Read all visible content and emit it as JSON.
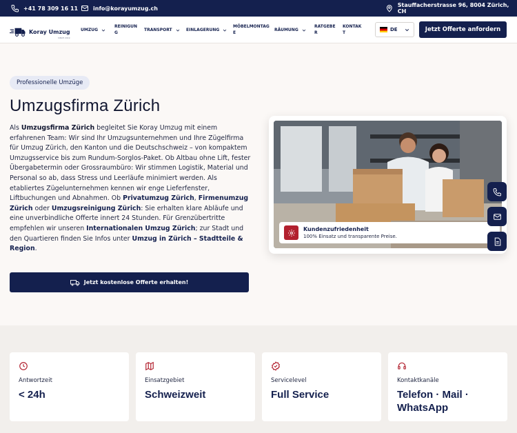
{
  "topbar": {
    "phone": "+41 78 309 16 11",
    "email": "info@korayumzug.ch",
    "address": "Stauffacherstrasse 96, 8004 Zürich, CH"
  },
  "nav": {
    "logo_text": "Koray Umzug",
    "logo_sub": "SINCE 2019",
    "items": [
      {
        "label": "UMZUG"
      },
      {
        "label": "REINIGUN G"
      },
      {
        "label": "TRANSPORT"
      },
      {
        "label": "EINLAGERUNG"
      },
      {
        "label": "MÖBELMONTAG E"
      },
      {
        "label": "RÄUMUNG"
      },
      {
        "label": "RATGEBE R"
      },
      {
        "label": "KONTAK T"
      }
    ],
    "language": "DE",
    "cta": "Jetzt Offerte anfordern"
  },
  "hero": {
    "badge": "Professionelle Umzüge",
    "title": "Umzugsfirma Zürich",
    "p": [
      "Als ",
      "Umzugsfirma Zürich",
      " begleitet Sie Koray Umzug mit einem erfahrenen Team: Wir sind Ihr Umzugsunternehmen und Ihre Zügelfirma für Umzug Zürich, den Kanton und die Deutschschweiz – von kompaktem Umzugsservice bis zum Rundum-Sorglos-Paket. Ob Altbau ohne Lift, fester Übergabetermin oder Grossraumbüro: Wir stimmen Logistik, Material und Personal so ab, dass Stress und Leerläufe minimiert werden. Als etabliertes Zügelunternehmen kennen wir enge Lieferfenster, Liftbuchungen und Abnahmen. Ob ",
      "Privatumzug Zürich",
      ", ",
      "Firmenumzug Zürich",
      " oder ",
      "Umzugsreinigung Zürich",
      ": Sie erhalten klare Abläufe und eine unverbindliche Offerte innert 24 Stunden. Für Grenzübertritte empfehlen wir unseren ",
      "Internationalen Umzug Zürich",
      "; zur Stadt und den Quartieren finden Sie Infos unter ",
      "Umzug in Zürich – Stadtteile & Region",
      "."
    ],
    "cta": "Jetzt kostenlose Offerte erhalten!"
  },
  "overlay": {
    "title": "Kundenzufriedenheit",
    "subtitle": "100% Einsatz und transparente Preise."
  },
  "stats": [
    {
      "icon": "clock-icon",
      "label": "Antwortzeit",
      "value": "< 24h"
    },
    {
      "icon": "map-icon",
      "label": "Einsatzgebiet",
      "value": "Schweizweit"
    },
    {
      "icon": "badge-check-icon",
      "label": "Servicelevel",
      "value": "Full Service"
    },
    {
      "icon": "headset-icon",
      "label": "Kontaktkanäle",
      "value": "Telefon · Mail · WhatsApp"
    }
  ],
  "colors": {
    "navy": "#14204e",
    "accent_red": "#b2202e",
    "background": "#fbf8f6",
    "band": "#f2efec"
  }
}
